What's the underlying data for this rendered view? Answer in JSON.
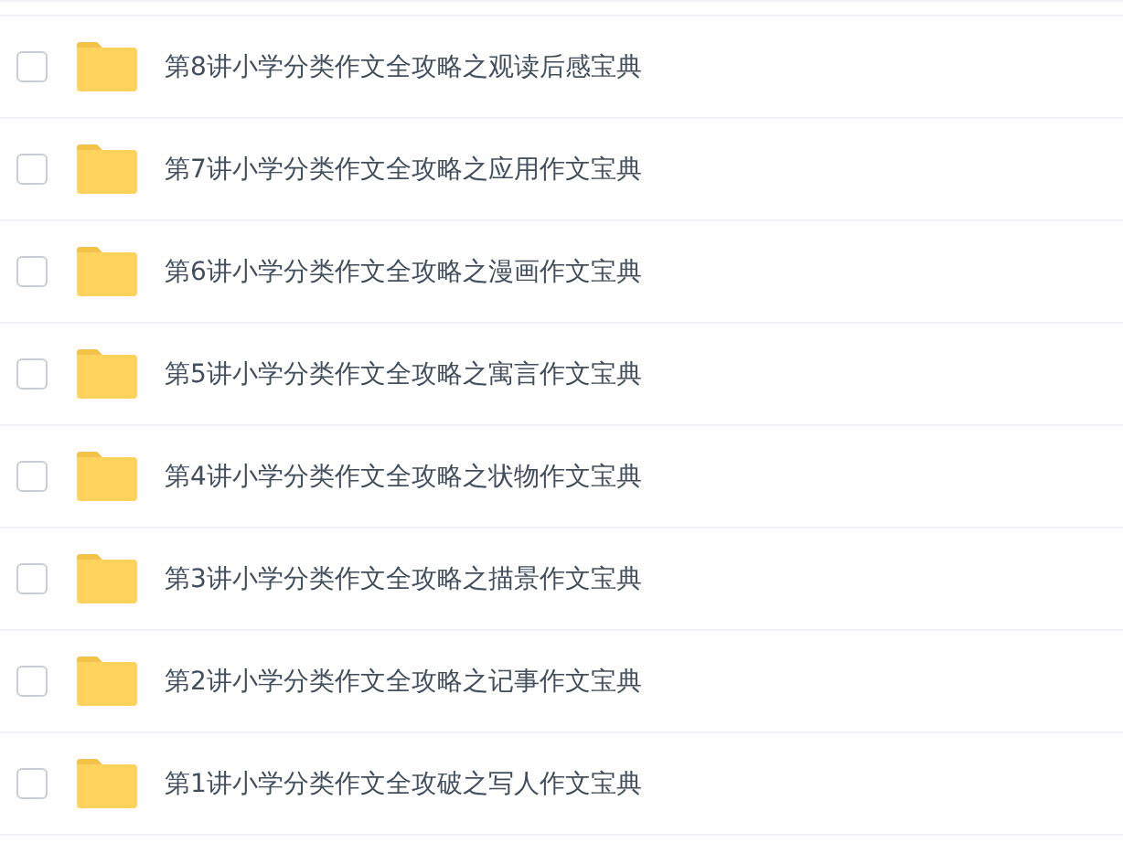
{
  "files": [
    {
      "name": "第8讲小学分类作文全攻略之观读后感宝典",
      "checked": false
    },
    {
      "name": "第7讲小学分类作文全攻略之应用作文宝典",
      "checked": false
    },
    {
      "name": "第6讲小学分类作文全攻略之漫画作文宝典",
      "checked": false
    },
    {
      "name": "第5讲小学分类作文全攻略之寓言作文宝典",
      "checked": false
    },
    {
      "name": "第4讲小学分类作文全攻略之状物作文宝典",
      "checked": false
    },
    {
      "name": "第3讲小学分类作文全攻略之描景作文宝典",
      "checked": false
    },
    {
      "name": "第2讲小学分类作文全攻略之记事作文宝典",
      "checked": false
    },
    {
      "name": "第1讲小学分类作文全攻破之写人作文宝典",
      "checked": false
    }
  ]
}
